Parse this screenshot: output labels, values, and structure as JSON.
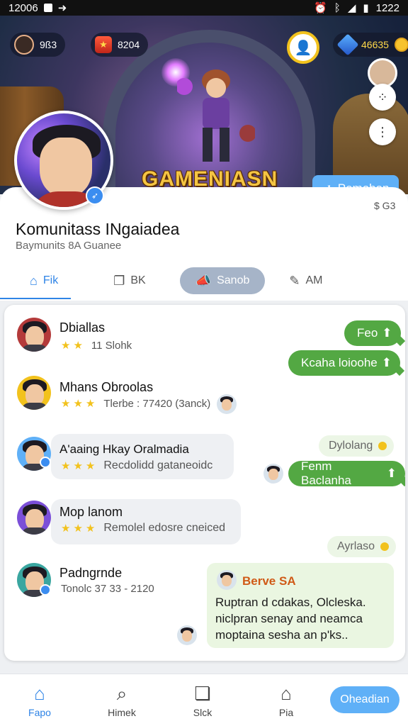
{
  "status_bar": {
    "time": "12006",
    "right_time": "1222"
  },
  "banner": {
    "player_level": "9ß3",
    "score": "8204",
    "currency": "46635",
    "title": "GAMENIASN",
    "join_label": "Pemoban"
  },
  "profile": {
    "price": "$ G3",
    "title": "Komunitass INgaiadea",
    "subtitle": "Baymunits 8A Guanee"
  },
  "tabs": [
    {
      "label": "Fik",
      "icon": "home-icon"
    },
    {
      "label": "BK",
      "icon": "copy-icon"
    },
    {
      "label": "Sanob",
      "icon": "megaphone-icon"
    },
    {
      "label": "AM",
      "icon": "chat-icon"
    }
  ],
  "feed": {
    "item1": {
      "name": "Dbiallas",
      "meta": "11 Slohk"
    },
    "item2": {
      "name": "Mhans Obroolas",
      "meta": "Tlerbe : 77420 (3anck)"
    },
    "item3": {
      "name": "A'aaing Hkay Oralmadia",
      "meta": "Recdolidd gataneoidc"
    },
    "item4": {
      "name": "Mop lanom",
      "meta": "Remolel edosre cneiced"
    },
    "item5": {
      "name": "Padngrnde",
      "meta": "Tonolc 37 33 - 2120"
    },
    "reply1": "Feo",
    "reply2": "Kcaha loioohe",
    "pending1": "Dylolang",
    "reply3": "Fenm Baclanha",
    "pending2": "Ayrlaso",
    "message": {
      "sender": "Berve SA",
      "text": "Ruptran d cdakas, Olcleska. niclpran senay and neamca moptaina sesha an p'ks.."
    }
  },
  "bottom_nav": {
    "items": [
      "Fapo",
      "Himek",
      "Slck",
      "Pia"
    ],
    "download": "Oheadian"
  },
  "colors": {
    "accent": "#2f84e6",
    "green": "#53a843",
    "gold": "#f2c21d"
  }
}
